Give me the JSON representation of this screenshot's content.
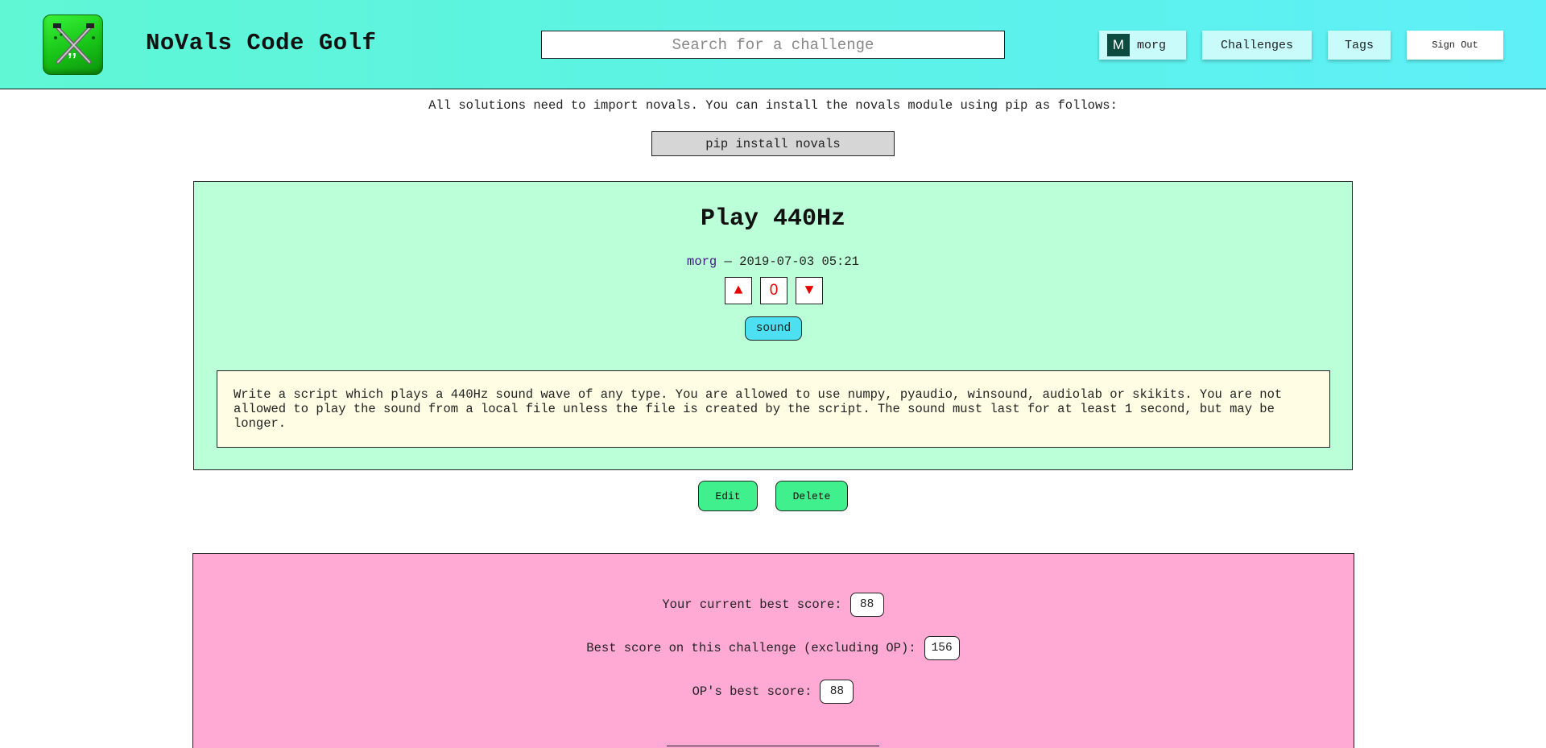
{
  "header": {
    "site_title": "NoVals Code Golf",
    "search_placeholder": "Search for a challenge",
    "user": {
      "initial": "M",
      "name": "morg"
    },
    "nav": {
      "challenges": "Challenges",
      "tags": "Tags",
      "sign_out": "Sign Out"
    }
  },
  "notice": {
    "text": "All solutions need to import novals. You can install the novals module using pip as follows:",
    "command": "pip install novals"
  },
  "challenge": {
    "title": "Play 440Hz",
    "author": "morg",
    "separator": " — ",
    "date": "2019-07-03 05:21",
    "votes": {
      "up": "▲",
      "count": "0",
      "down": "▼"
    },
    "tags": [
      "sound"
    ],
    "description": "Write a script which plays a 440Hz sound wave of any type. You are allowed to use numpy, pyaudio, winsound, audiolab or skikits. You are not allowed to play the sound from a local file unless the file is created by the script. The sound must last for at least 1 second, but may be longer.",
    "actions": {
      "edit": "Edit",
      "delete": "Delete"
    }
  },
  "scores": {
    "current_best_label": "Your current best score:",
    "current_best": "88",
    "challenge_best_label": "Best score on this challenge (excluding OP):",
    "challenge_best": "156",
    "op_best_label": "OP's best score:",
    "op_best": "88"
  },
  "colors": {
    "header_bg": "#5ef2e4",
    "card_bg": "#bbffd9",
    "desc_bg": "#fffde4",
    "tag_bg": "#4ce0f2",
    "action_bg": "#3ff08d",
    "scores_bg": "#ffaad5",
    "vote_arrow": "#e60000"
  },
  "icons": {
    "logo": "golf-clubs-logo-icon"
  }
}
